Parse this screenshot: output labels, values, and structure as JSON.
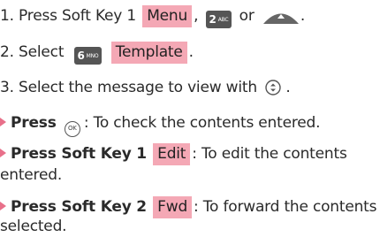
{
  "steps": [
    {
      "num": "1.",
      "pre": "Press Soft Key 1",
      "highlight": "Menu",
      "comma": ",",
      "key_label": "2",
      "key_sub": "ABC",
      "or": "or",
      "end": "."
    },
    {
      "num": "2.",
      "pre": "Select",
      "key_label": "6",
      "key_sub": "MNO",
      "highlight": "Template",
      "end": "."
    },
    {
      "num": "3.",
      "pre": "Select the message to view with",
      "end": "."
    }
  ],
  "bullets": [
    {
      "bold": "Press",
      "icon_text": "OK",
      "rest": ": To check the contents entered."
    },
    {
      "bold": "Press Soft Key 1",
      "highlight": "Edit",
      "rest": ": To edit the contents",
      "rest2": "entered."
    },
    {
      "bold": "Press Soft Key 2",
      "highlight": "Fwd",
      "rest": ": To forward the contents",
      "rest2": "selected."
    }
  ],
  "colors": {
    "highlight": "#f4a8b5",
    "bullet": "#e8708a",
    "key_bg": "#555555"
  }
}
